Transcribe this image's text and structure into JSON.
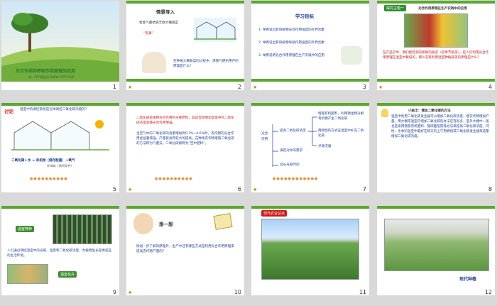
{
  "slides": [
    {
      "num": "1",
      "title": "光合作用和呼吸作用原理的应用",
      "subtitle": "第一PPT模板网-WWW.1PPT.COM"
    },
    {
      "num": "2",
      "header": "情景导入",
      "question": "智能气肥抗病丰收大棚蔬菜",
      "quote": "“无毒”",
      "body": "在种植大棚蔬菜的过程中，增施气肥抗用产的原理是什么？"
    },
    {
      "num": "3",
      "header": "学习目标",
      "items": [
        "1. 举例说出影响植物光合作用强度的外界因素",
        "2. 举例说出影响植物呼吸作用强度的外界因素",
        "3. 举例说明光合作用原理在生产实践中的应用"
      ]
    },
    {
      "num": "4",
      "header": "探究主题一",
      "subhead": "光合作用原理在生产实践中的应用",
      "body": "在产品学中，我们能吃到的新鲜的蔬菜（反季节蔬菜），是人们利用光合作用原理在温室中栽培的，那么农民利用温室种植蔬菜的原理是什么？"
    },
    {
      "num": "5",
      "header": "讨论",
      "question": "温室中的调控系统是怎样调控二氧化碳浓度的？",
      "formula": "二氧化碳＋水 → 有机物（储存能量）＋氧气",
      "sub": "叶绿体（场所条件）"
    },
    {
      "num": "6",
      "body1": "二氧化碳是植物光合作用的主要原料，其适当地增加温室中的二氧化碳浓度会使光合作用增强。",
      "body2": "当空气中的二氧化碳的含量增加到0.3%~0.6%时，农作物的光合作用会显著增强，产量就会有较大的提高。这种将农作物增施二氧化碳的方法称为气肥法，二氧化碳被称为“空中肥料”。"
    },
    {
      "num": "7",
      "root": "光合作用",
      "branches": [
        "提高二氧化碳浓度",
        "满足对水的需求",
        "延长光照时间"
      ],
      "leaves": [
        "增施有机肥料，利用微生物分解有机物产生二氧化碳",
        "用燃烧的方式在温室中补充二氧化碳",
        "点滴浇灌"
      ]
    },
    {
      "num": "8",
      "header": "小贴士：增加二氧化碳的方法",
      "body": "温室中利用二氧化碳发生器可以增加二氧化碳浓度，使农作物增加产量。用大棚或温室内增加二氧化碳的办法还有很多，室外大棚中一般也是采用增施有机肥料、施碳酸氢铵等办法来提高二氧化碳浓度，同时，冬季的温室中最好在晴天的上午用燃烧或二氧化碳发生器来适量增加二氧化碳浓度。"
    },
    {
      "num": "9",
      "tag1": "温室育种",
      "body": "人们通过调控温室中的光照、温度和二氧化碳浓度，为植物生长提供适宜的生活环境。",
      "tag2": "温室花卉"
    },
    {
      "num": "10",
      "header": "想一想",
      "body": "除进一步了解的原理外，生产中还有哪些方式是利用光合作用原理来提高农作物产量的？"
    },
    {
      "num": "11",
      "header": "现代农业试点"
    },
    {
      "num": "12",
      "caption": "现代种植"
    }
  ],
  "colors": {
    "green": "#5aa82e",
    "darkgreen": "#2f8f2f",
    "red": "#d01818",
    "bg": "#d9d9d9"
  }
}
